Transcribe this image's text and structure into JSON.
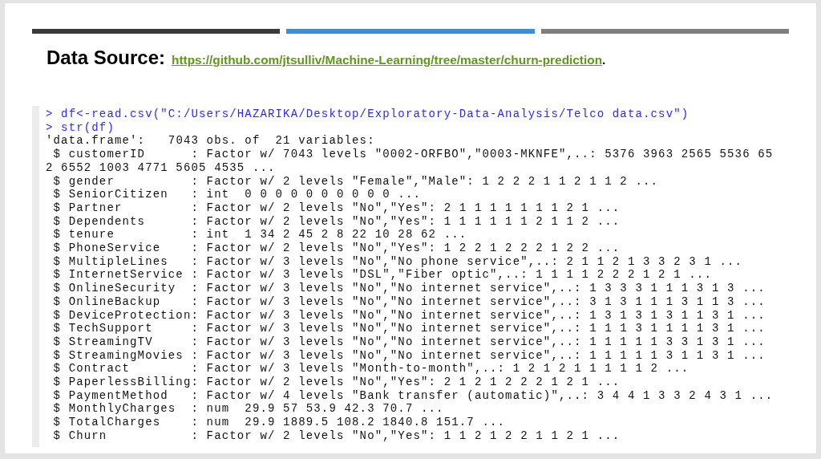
{
  "header_bars": [
    {
      "color": "#3a3a3a"
    },
    {
      "color": "#3b8fd9"
    },
    {
      "color": "#7f7f7f"
    }
  ],
  "title": {
    "label": "Data Source:",
    "link": "https://github.com/jtsulliv/Machine-Learning/tree/master/churn-prediction",
    "suffix": "."
  },
  "console": {
    "lines": [
      {
        "kind": "input",
        "text": "> df<-read.csv(\"C:/Users/HAZARIKA/Desktop/Exploratory-Data-Analysis/Telco data.csv\")"
      },
      {
        "kind": "input",
        "text": "> str(df)"
      },
      {
        "kind": "output",
        "text": "'data.frame':\t7043 obs. of  21 variables:"
      },
      {
        "kind": "output",
        "text": " $ customerID      : Factor w/ 7043 levels \"0002-ORFBO\",\"0003-MKNFE\",..: 5376 3963 2565 5536 65"
      },
      {
        "kind": "output",
        "text": "2 6552 1003 4771 5605 4535 ..."
      },
      {
        "kind": "output",
        "text": " $ gender          : Factor w/ 2 levels \"Female\",\"Male\": 1 2 2 2 1 1 2 1 1 2 ..."
      },
      {
        "kind": "output",
        "text": " $ SeniorCitizen   : int  0 0 0 0 0 0 0 0 0 0 ..."
      },
      {
        "kind": "output",
        "text": " $ Partner         : Factor w/ 2 levels \"No\",\"Yes\": 2 1 1 1 1 1 1 1 2 1 ..."
      },
      {
        "kind": "output",
        "text": " $ Dependents      : Factor w/ 2 levels \"No\",\"Yes\": 1 1 1 1 1 1 2 1 1 2 ..."
      },
      {
        "kind": "output",
        "text": " $ tenure          : int  1 34 2 45 2 8 22 10 28 62 ..."
      },
      {
        "kind": "output",
        "text": " $ PhoneService    : Factor w/ 2 levels \"No\",\"Yes\": 1 2 2 1 2 2 2 1 2 2 ..."
      },
      {
        "kind": "output",
        "text": " $ MultipleLines   : Factor w/ 3 levels \"No\",\"No phone service\",..: 2 1 1 2 1 3 3 2 3 1 ..."
      },
      {
        "kind": "output",
        "text": " $ InternetService : Factor w/ 3 levels \"DSL\",\"Fiber optic\",..: 1 1 1 1 2 2 2 1 2 1 ..."
      },
      {
        "kind": "output",
        "text": " $ OnlineSecurity  : Factor w/ 3 levels \"No\",\"No internet service\",..: 1 3 3 3 1 1 1 3 1 3 ..."
      },
      {
        "kind": "output",
        "text": " $ OnlineBackup    : Factor w/ 3 levels \"No\",\"No internet service\",..: 3 1 3 1 1 1 3 1 1 3 ..."
      },
      {
        "kind": "output",
        "text": " $ DeviceProtection: Factor w/ 3 levels \"No\",\"No internet service\",..: 1 3 1 3 1 3 1 1 3 1 ..."
      },
      {
        "kind": "output",
        "text": " $ TechSupport     : Factor w/ 3 levels \"No\",\"No internet service\",..: 1 1 1 3 1 1 1 1 3 1 ..."
      },
      {
        "kind": "output",
        "text": " $ StreamingTV     : Factor w/ 3 levels \"No\",\"No internet service\",..: 1 1 1 1 1 3 3 1 3 1 ..."
      },
      {
        "kind": "output",
        "text": " $ StreamingMovies : Factor w/ 3 levels \"No\",\"No internet service\",..: 1 1 1 1 1 3 1 1 3 1 ..."
      },
      {
        "kind": "output",
        "text": " $ Contract        : Factor w/ 3 levels \"Month-to-month\",..: 1 2 1 2 1 1 1 1 1 2 ..."
      },
      {
        "kind": "output",
        "text": " $ PaperlessBilling: Factor w/ 2 levels \"No\",\"Yes\": 2 1 2 1 2 2 2 1 2 1 ..."
      },
      {
        "kind": "output",
        "text": " $ PaymentMethod   : Factor w/ 4 levels \"Bank transfer (automatic)\",..: 3 4 4 1 3 3 2 4 3 1 ..."
      },
      {
        "kind": "output",
        "text": " $ MonthlyCharges  : num  29.9 57 53.9 42.3 70.7 ..."
      },
      {
        "kind": "output",
        "text": " $ TotalCharges    : num  29.9 1889.5 108.2 1840.8 151.7 ..."
      },
      {
        "kind": "output",
        "text": " $ Churn           : Factor w/ 2 levels \"No\",\"Yes\": 1 1 2 1 2 2 1 1 2 1 ..."
      }
    ]
  }
}
